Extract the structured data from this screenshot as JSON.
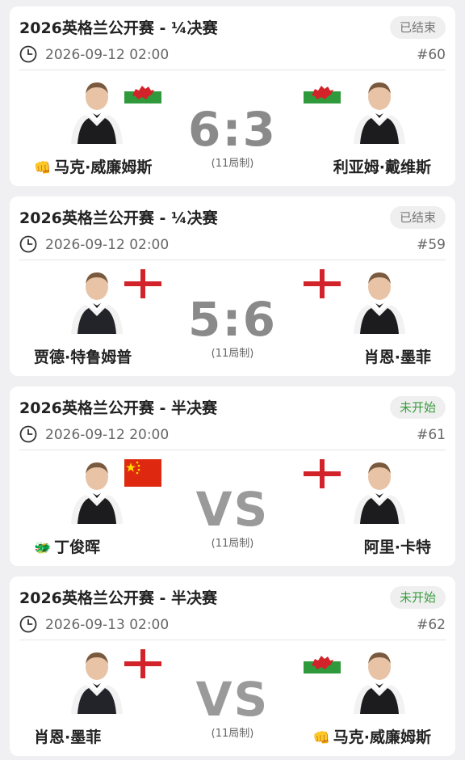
{
  "matches": [
    {
      "title": "2026英格兰公开赛 - ¼决赛",
      "status": "已结束",
      "status_type": "ended",
      "datetime": "2026-09-12 02:00",
      "match_no": "#60",
      "left_player": {
        "name": "马克·威廉姆斯",
        "flag": "wales-flag",
        "badge": "👊"
      },
      "right_player": {
        "name": "利亚姆·戴维斯",
        "flag": "wales-flag",
        "badge": ""
      },
      "score": "6:3",
      "format": "(11局制)"
    },
    {
      "title": "2026英格兰公开赛 - ¼决赛",
      "status": "已结束",
      "status_type": "ended",
      "datetime": "2026-09-12 02:00",
      "match_no": "#59",
      "left_player": {
        "name": "贾德·特鲁姆普",
        "flag": "england-flag",
        "badge": ""
      },
      "right_player": {
        "name": "肖恩·墨菲",
        "flag": "england-flag",
        "badge": ""
      },
      "score": "5:6",
      "format": "(11局制)"
    },
    {
      "title": "2026英格兰公开赛 - 半决赛",
      "status": "未开始",
      "status_type": "upcoming",
      "datetime": "2026-09-12 20:00",
      "match_no": "#61",
      "left_player": {
        "name": "丁俊晖",
        "flag": "china-flag",
        "badge": "🐲"
      },
      "right_player": {
        "name": "阿里·卡特",
        "flag": "england-flag",
        "badge": ""
      },
      "score": "VS",
      "format": "(11局制)"
    },
    {
      "title": "2026英格兰公开赛 - 半决赛",
      "status": "未开始",
      "status_type": "upcoming",
      "datetime": "2026-09-13 02:00",
      "match_no": "#62",
      "left_player": {
        "name": "肖恩·墨菲",
        "flag": "england-flag",
        "badge": ""
      },
      "right_player": {
        "name": "马克·威廉姆斯",
        "flag": "wales-flag",
        "badge": "👊"
      },
      "score": "VS",
      "format": "(11局制)"
    }
  ],
  "colors": {
    "ended_text": "#777777",
    "upcoming_text": "#3a9d3f",
    "score": "#8a8a8a"
  }
}
